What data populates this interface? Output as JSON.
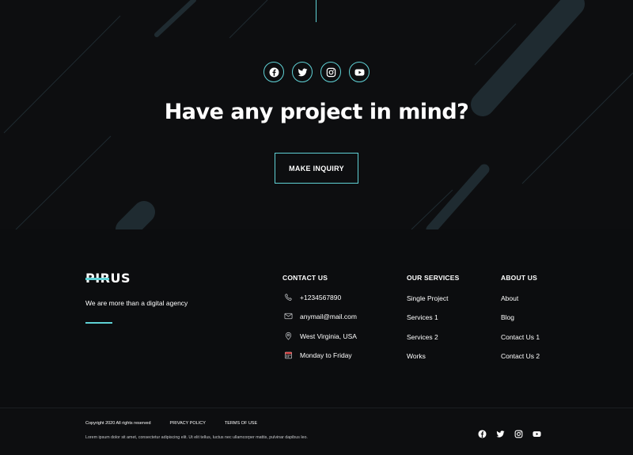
{
  "colors": {
    "accent": "#5fd1d5",
    "background": "#0d0e10",
    "text": "#ffffff"
  },
  "cta": {
    "social_icons": [
      "facebook-icon",
      "twitter-icon",
      "instagram-icon",
      "youtube-icon"
    ],
    "title": "Have any project in mind?",
    "button_label": "MAKE INQUIRY"
  },
  "brand": {
    "logo_text": "PIRUS",
    "tagline": "We are more than a digital agency"
  },
  "contact": {
    "title": "CONTACT US",
    "items": [
      {
        "icon": "phone-icon",
        "text": "+1234567890"
      },
      {
        "icon": "mail-icon",
        "text": "anymail@mail.com"
      },
      {
        "icon": "location-pin-icon",
        "text": "West Virginia, USA"
      },
      {
        "icon": "calendar-icon",
        "text": "Monday to Friday"
      }
    ]
  },
  "services": {
    "title": "OUR SERVICES",
    "items": [
      "Single Project",
      "Services 1",
      "Services 2",
      "Works"
    ]
  },
  "about": {
    "title": "ABOUT US",
    "items": [
      "About",
      "Blog",
      "Contact Us 1",
      "Contact Us 2"
    ]
  },
  "bottom": {
    "copyright": "Copyright 2020 All rights reserved",
    "privacy": "PRIVACY POLICY",
    "terms": "TERMS OF USE",
    "lorem": "Lorem ipsum dolor sit amet, consectetur adipiscing elit. Ut elit tellus, luctus nec ullamcorper mattis, pulvinar dapibus leo.",
    "social_icons": [
      "facebook-icon",
      "twitter-icon",
      "instagram-icon",
      "youtube-icon"
    ]
  }
}
